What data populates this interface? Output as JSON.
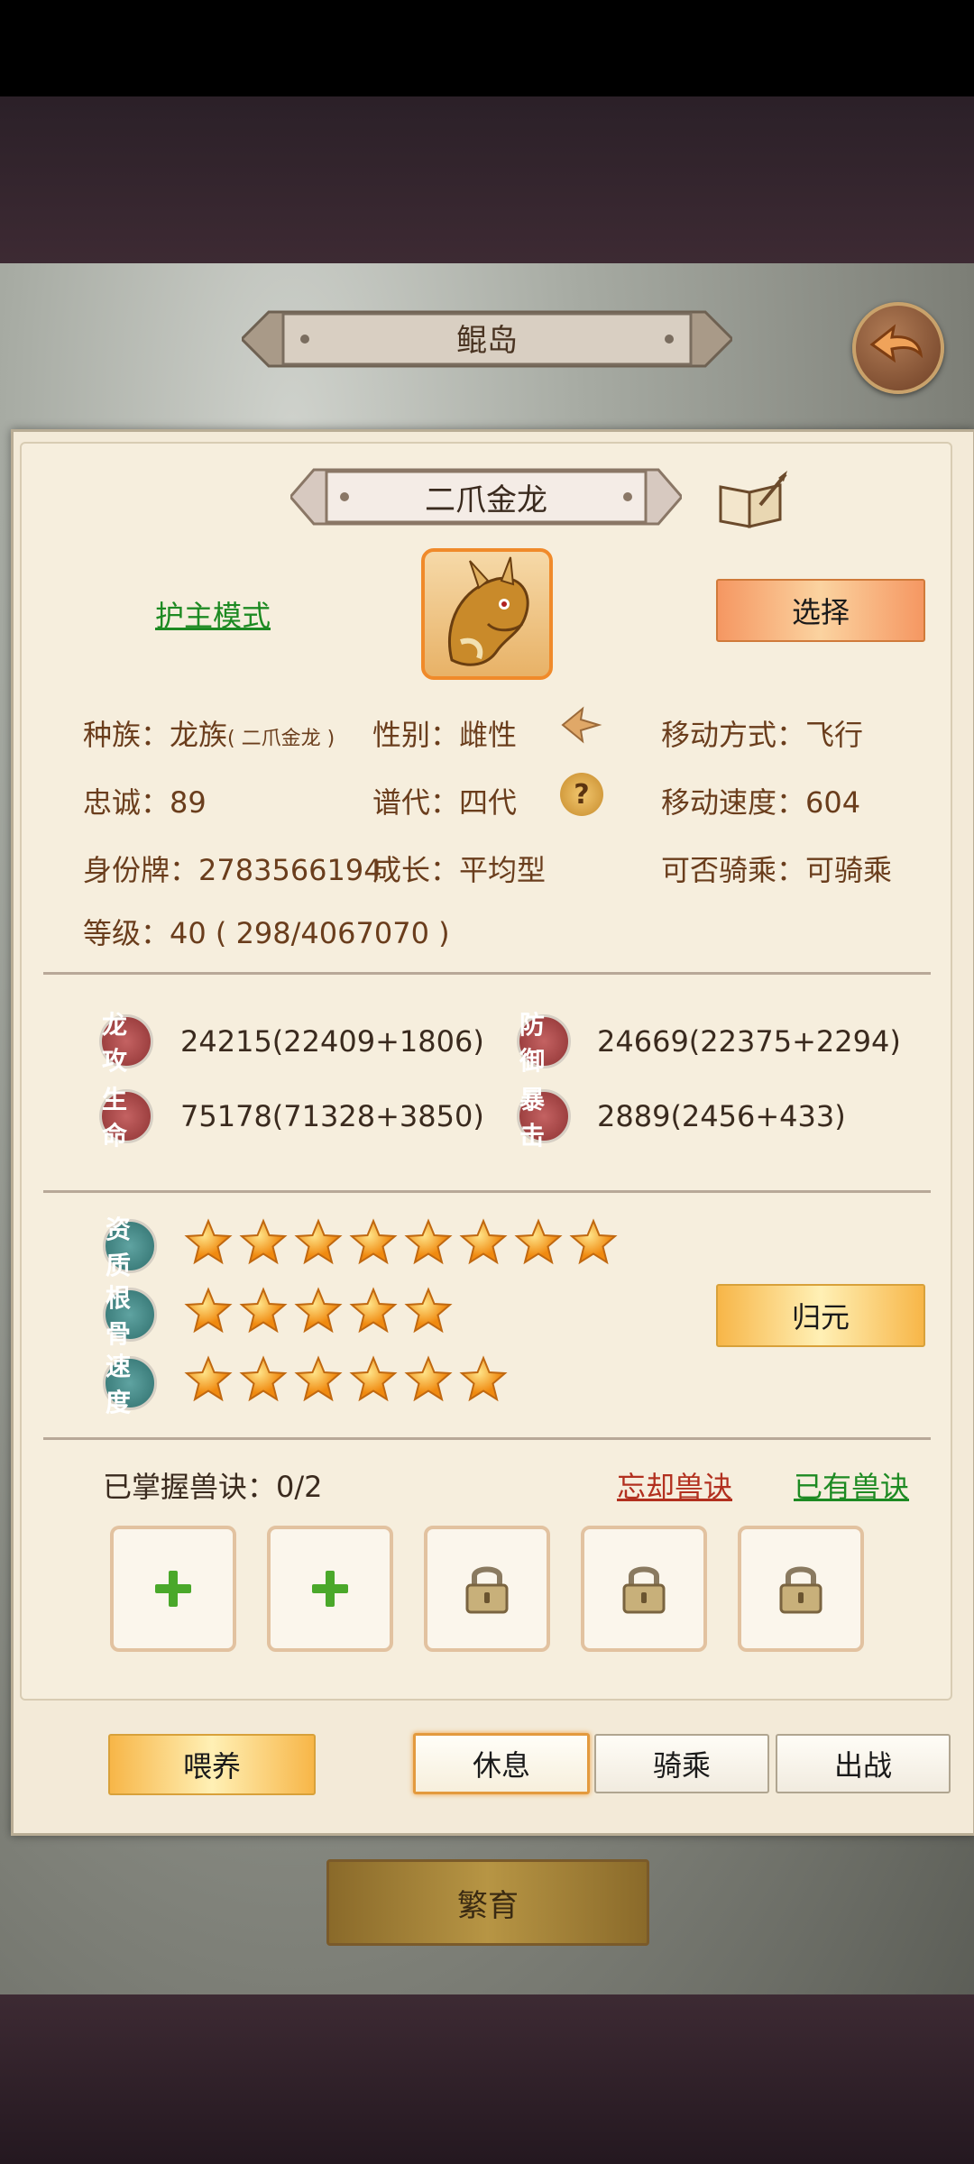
{
  "header": {
    "title": "鲲岛"
  },
  "pet": {
    "name": "二爪金龙",
    "mode_link": "护主模式",
    "select_label": "选择"
  },
  "info": {
    "race_label": "种族：",
    "race_value": "龙族",
    "race_sub": "( 二爪金龙 )",
    "gender_label": "性别：",
    "gender_value": "雌性",
    "move_label": "移动方式：",
    "move_value": "飞行",
    "loyalty_label": "忠诚：",
    "loyalty_value": "89",
    "gen_label": "谱代：",
    "gen_value": "四代",
    "speed_label": "移动速度：",
    "speed_value": "604",
    "id_label": "身份牌：",
    "id_value": "2783566194",
    "growth_label": "成长：",
    "growth_value": "平均型",
    "ride_label": "可否骑乘：",
    "ride_value": "可骑乘",
    "level_label": "等级：",
    "level_value": "40 ( 298/4067070 )"
  },
  "stats": [
    {
      "badge": "龙攻",
      "value": "24215(22409+1806)"
    },
    {
      "badge": "防御",
      "value": "24669(22375+2294)"
    },
    {
      "badge": "生命",
      "value": "75178(71328+3850)"
    },
    {
      "badge": "暴击",
      "value": "2889(2456+433)"
    }
  ],
  "ratings": [
    {
      "badge": "资质",
      "stars": 8
    },
    {
      "badge": "根骨",
      "stars": 5
    },
    {
      "badge": "速度",
      "stars": 6
    }
  ],
  "restore_label": "归元",
  "skills": {
    "mastered_label": "已掌握兽诀：",
    "mastered_value": "0/2",
    "forget_link": "忘却兽诀",
    "owned_link": "已有兽诀",
    "slots": [
      "add",
      "add",
      "locked",
      "locked",
      "locked"
    ]
  },
  "actions": {
    "feed": "喂养",
    "rest": "休息",
    "ride": "骑乘",
    "battle": "出战"
  },
  "breed_label": "繁育",
  "colors": {
    "accent_orange": "#f59762",
    "link_green": "#1d8a22",
    "link_red": "#b2301f",
    "text_brown": "#6a3d1c"
  }
}
